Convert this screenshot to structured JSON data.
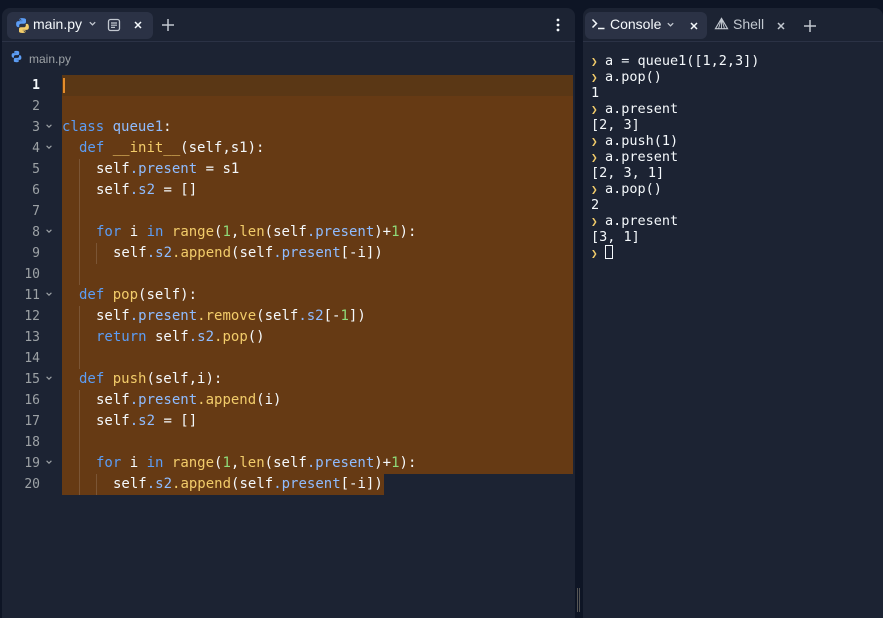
{
  "editor": {
    "tab_label": "main.py",
    "breadcrumb": "main.py",
    "lines": [
      {
        "n": "1"
      },
      {
        "n": "2"
      },
      {
        "n": "3"
      },
      {
        "n": "4"
      },
      {
        "n": "5"
      },
      {
        "n": "6"
      },
      {
        "n": "7"
      },
      {
        "n": "8"
      },
      {
        "n": "9"
      },
      {
        "n": "10"
      },
      {
        "n": "11"
      },
      {
        "n": "12"
      },
      {
        "n": "13"
      },
      {
        "n": "14"
      },
      {
        "n": "15"
      },
      {
        "n": "16"
      },
      {
        "n": "17"
      },
      {
        "n": "18"
      },
      {
        "n": "19"
      },
      {
        "n": "20"
      }
    ],
    "code": {
      "l3": [
        "class",
        "queue1",
        ":"
      ],
      "l4": [
        "def",
        "__init__",
        "(self,s1):"
      ],
      "l5": [
        "self",
        ".present",
        " = s1"
      ],
      "l6": [
        "self",
        ".s2",
        " = []"
      ],
      "l8": [
        "for",
        " i ",
        "in",
        " ",
        "range",
        "(",
        "1",
        ",",
        "len",
        "(self",
        ".present",
        ")+",
        "1",
        "):"
      ],
      "l9": [
        "self",
        ".s2",
        ".append",
        "(self",
        ".present",
        "[-i])"
      ],
      "l11": [
        "def",
        "pop",
        "(self):"
      ],
      "l12": [
        "self",
        ".present",
        ".remove",
        "(self",
        ".s2",
        "[-",
        "1",
        "])"
      ],
      "l13": [
        "return",
        " self",
        ".s2",
        ".pop",
        "()"
      ],
      "l15": [
        "def",
        "push",
        "(self,i):"
      ],
      "l16": [
        "self",
        ".present",
        ".append",
        "(i)"
      ],
      "l17": [
        "self",
        ".s2",
        " = []"
      ],
      "l19": [
        "for",
        " i ",
        "in",
        " ",
        "range",
        "(",
        "1",
        ",",
        "len",
        "(self",
        ".present",
        ")+",
        "1",
        "):"
      ],
      "l20": [
        "self",
        ".s2",
        ".append",
        "(self",
        ".present",
        "[-i])"
      ]
    }
  },
  "console": {
    "tab_label": "Console",
    "shell_label": "Shell",
    "output": [
      {
        "type": "in",
        "text": "a = queue1([1,2,3])"
      },
      {
        "type": "in",
        "text": "a.pop()"
      },
      {
        "type": "out",
        "text": "1"
      },
      {
        "type": "in",
        "text": "a.present"
      },
      {
        "type": "out",
        "text": "[2, 3]"
      },
      {
        "type": "in",
        "text": "a.push(1)"
      },
      {
        "type": "in",
        "text": "a.present"
      },
      {
        "type": "out",
        "text": "[2, 3, 1]"
      },
      {
        "type": "in",
        "text": "a.pop()"
      },
      {
        "type": "out",
        "text": "2"
      },
      {
        "type": "in",
        "text": "a.present"
      },
      {
        "type": "out",
        "text": "[3, 1]"
      }
    ]
  },
  "icons": {
    "python": "python-icon",
    "chevron": "chevron-down-icon",
    "doc": "document-icon",
    "close": "close-icon",
    "add": "plus-icon",
    "menu": "kebab-menu-icon",
    "terminal": "terminal-icon",
    "shell": "shell-icon"
  },
  "colors": {
    "background": "#0e1525",
    "pane": "#1c2333",
    "selection": "#663a14",
    "keyword": "#5c9df5",
    "function": "#f2cc6a",
    "number": "#8fdc7a"
  }
}
